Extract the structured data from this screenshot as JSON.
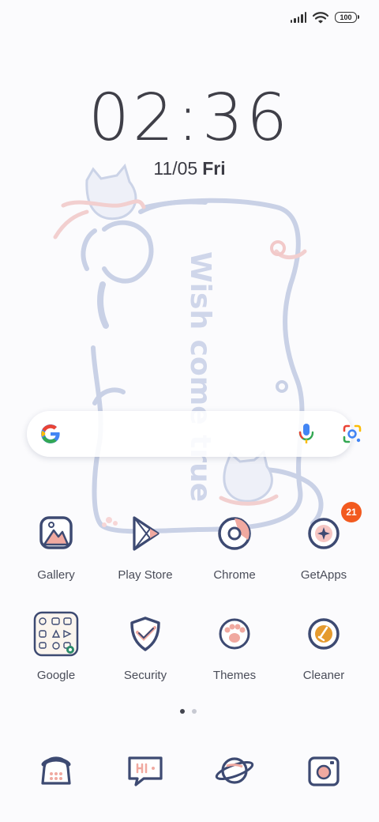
{
  "status_bar": {
    "battery": "100",
    "icons": [
      "signal-icon",
      "wifi-icon",
      "battery-icon"
    ]
  },
  "clock": {
    "time": "02:36",
    "date": "11/05",
    "day": "Fri"
  },
  "wallpaper": {
    "text": "Wish come true"
  },
  "search_bar": {
    "icons": [
      "google-logo-icon",
      "microphone-icon",
      "google-lens-icon"
    ]
  },
  "apps_row1": [
    {
      "label": "Gallery",
      "icon": "gallery-icon"
    },
    {
      "label": "Play Store",
      "icon": "play-store-icon"
    },
    {
      "label": "Chrome",
      "icon": "chrome-icon"
    },
    {
      "label": "GetApps",
      "icon": "getapps-icon",
      "badge": "21"
    }
  ],
  "apps_row2": [
    {
      "label": "Google",
      "icon": "google-folder-icon"
    },
    {
      "label": "Security",
      "icon": "security-icon"
    },
    {
      "label": "Themes",
      "icon": "themes-icon"
    },
    {
      "label": "Cleaner",
      "icon": "cleaner-icon"
    }
  ],
  "page_indicator": {
    "pages": 2,
    "current": 1
  },
  "dock": [
    {
      "icon": "phone-icon"
    },
    {
      "icon": "messaging-icon"
    },
    {
      "icon": "browser-icon"
    },
    {
      "icon": "camera-icon"
    }
  ],
  "colors": {
    "accent": "#f25a1f",
    "line": "#3d4a72",
    "pink": "#f0a9a0",
    "wallpaper_line": "#c8d0e6"
  }
}
